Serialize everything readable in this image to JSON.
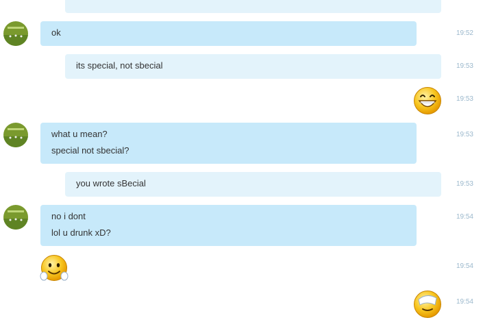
{
  "messages": [
    {
      "side": "out",
      "kind": "text",
      "lines": [
        "..."
      ],
      "time": ""
    },
    {
      "side": "in",
      "kind": "text",
      "lines": [
        "ok"
      ],
      "time": "19:52"
    },
    {
      "side": "out",
      "kind": "text",
      "lines": [
        "its special, not sbecial"
      ],
      "time": "19:53"
    },
    {
      "side": "out",
      "kind": "emoticon",
      "emoticon": "big-smile-emoticon",
      "time": "19:53"
    },
    {
      "side": "in",
      "kind": "text",
      "lines": [
        "what u mean?",
        "special not sbecial?"
      ],
      "time": "19:53"
    },
    {
      "side": "out",
      "kind": "text",
      "lines": [
        "you wrote sBecial"
      ],
      "time": "19:53"
    },
    {
      "side": "in",
      "kind": "text",
      "lines": [
        "no i dont",
        "lol u drunk xD?"
      ],
      "time": "19:54"
    },
    {
      "side": "in",
      "kind": "emoticon",
      "emoticon": "blush-emoticon",
      "time": "19:54"
    },
    {
      "side": "out",
      "kind": "emoticon",
      "emoticon": "facepalm-emoticon",
      "time": "19:54"
    }
  ],
  "colors": {
    "incoming_bubble": "#c7e9fa",
    "outgoing_bubble": "#e3f3fb",
    "timestamp": "#9bb8cc",
    "text": "#333333"
  }
}
